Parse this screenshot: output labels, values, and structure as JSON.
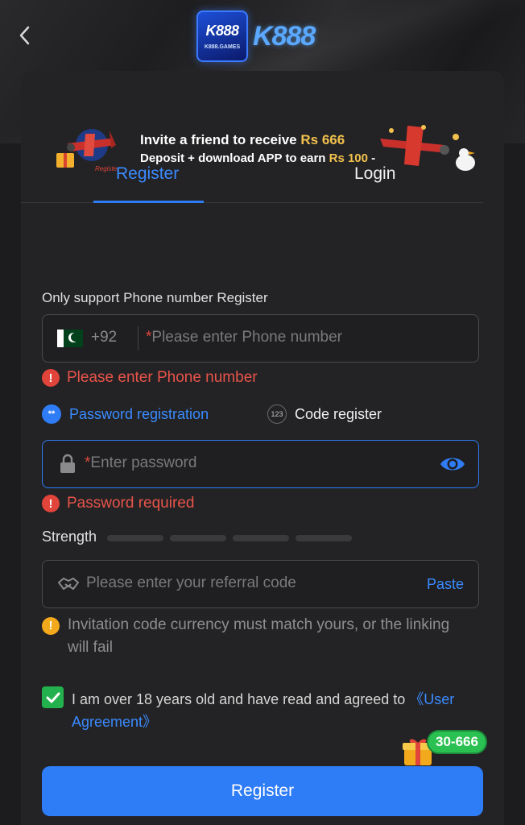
{
  "header": {
    "logo_box_text": "K888",
    "logo_box_sub": "K888.GAMES",
    "logo_text": "K888"
  },
  "banner": {
    "line1_prefix": "Invite a friend to receive",
    "line1_amount": "Rs 666",
    "line2_prefix": "Deposit + download APP to earn",
    "line2_amount": "Rs 100",
    "line2_suffix": "-"
  },
  "tabs": [
    {
      "label": "Register",
      "active": true
    },
    {
      "label": "Login",
      "active": false
    }
  ],
  "form": {
    "support_label": "Only support Phone number Register",
    "phone": {
      "country_code": "+92",
      "required_mark": "*",
      "placeholder": "Please enter Phone number",
      "value": "",
      "error": "Please enter Phone number"
    },
    "register_methods": [
      {
        "label": "Password registration",
        "icon": "**",
        "selected": true
      },
      {
        "label": "Code register",
        "icon": "123",
        "selected": false
      }
    ],
    "password": {
      "required_mark": "*",
      "placeholder": "Enter password",
      "value": "",
      "error": "Password required"
    },
    "strength": {
      "label": "Strength",
      "level": 0,
      "segments": 4
    },
    "referral": {
      "placeholder": "Please enter your referral code",
      "value": "",
      "paste_label": "Paste",
      "warning": "Invitation code currency must match yours, or the linking will fail"
    },
    "agreement": {
      "checked": true,
      "text": "I am over 18 years old and have read and agreed to ",
      "link": "《User Agreement》"
    },
    "submit_label": "Register"
  },
  "promo": {
    "badge": "30-666"
  },
  "colors": {
    "accent": "#2e7cf6",
    "error": "#e8534a",
    "warning": "#f2a91c",
    "success": "#23b14d",
    "gold": "#f2c14e"
  },
  "icons": [
    "back-arrow-icon",
    "pakistan-flag-icon",
    "lock-icon",
    "eye-icon",
    "handshake-icon",
    "error-icon",
    "warning-icon",
    "check-icon",
    "gift-icon"
  ]
}
